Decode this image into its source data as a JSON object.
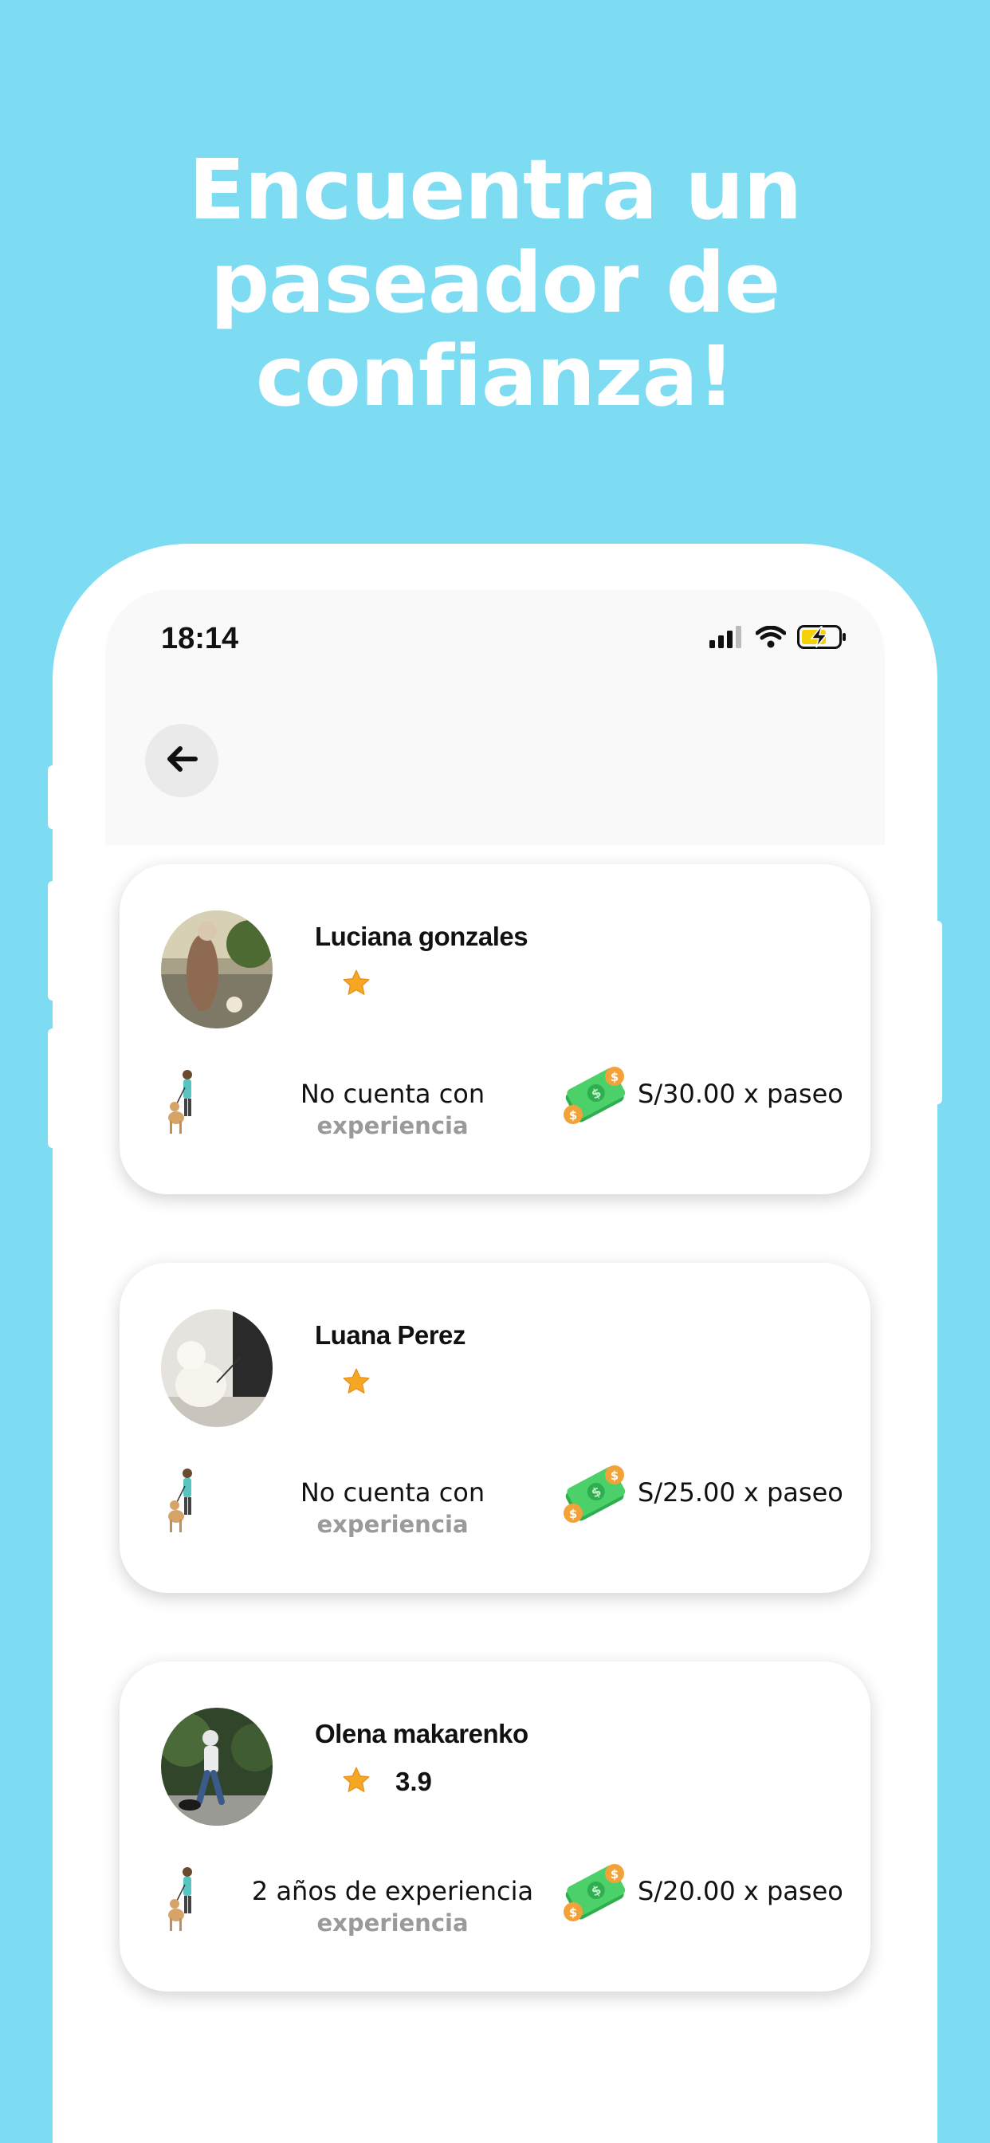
{
  "headline": {
    "line1": "Encuentra un",
    "line2": "paseador de",
    "line3": "confianza!"
  },
  "status_bar": {
    "time": "18:14",
    "icons": [
      "signal-icon",
      "wifi-icon",
      "battery-charging-icon"
    ]
  },
  "nav": {
    "back_icon": "arrow-left-icon"
  },
  "walkers": [
    {
      "name": "Luciana gonzales",
      "rating": "",
      "experience_line1": "No cuenta con",
      "experience_line2": "experiencia",
      "price": "S/30.00 x paseo"
    },
    {
      "name": "Luana Perez",
      "rating": "",
      "experience_line1": "No cuenta con",
      "experience_line2": "experiencia",
      "price": "S/25.00 x paseo"
    },
    {
      "name": "Olena makarenko",
      "rating": "3.9",
      "experience_line1": "2 años de experiencia",
      "experience_line2": "experiencia",
      "price": "S/20.00 x paseo"
    }
  ],
  "colors": {
    "background": "#7ddcf2",
    "star": "#f5a623",
    "muted_text": "#9a9a9a"
  }
}
